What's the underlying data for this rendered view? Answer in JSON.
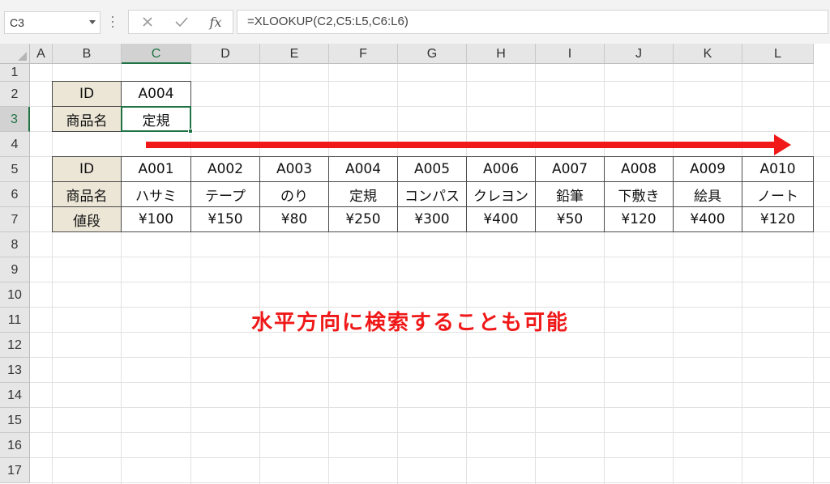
{
  "name_box": {
    "value": "C3"
  },
  "formula_bar": {
    "fx_label": "fx",
    "formula": "=XLOOKUP(C2,C5:L5,C6:L6)"
  },
  "columns": [
    "A",
    "B",
    "C",
    "D",
    "E",
    "F",
    "G",
    "H",
    "I",
    "J",
    "K",
    "L"
  ],
  "selected_column": "C",
  "rows": [
    "1",
    "2",
    "3",
    "4",
    "5",
    "6",
    "7",
    "8",
    "9",
    "10",
    "11",
    "12",
    "13",
    "14",
    "15",
    "16",
    "17"
  ],
  "selected_row": "3",
  "lookup_table": {
    "id_label": "ID",
    "id_value": "A004",
    "name_label": "商品名",
    "name_value": "定規"
  },
  "data_table": {
    "row_labels": [
      "ID",
      "商品名",
      "値段"
    ],
    "ids": [
      "A001",
      "A002",
      "A003",
      "A004",
      "A005",
      "A006",
      "A007",
      "A008",
      "A009",
      "A010"
    ],
    "names": [
      "ハサミ",
      "テープ",
      "のり",
      "定規",
      "コンパス",
      "クレヨン",
      "鉛筆",
      "下敷き",
      "絵具",
      "ノート"
    ],
    "prices": [
      "¥100",
      "¥150",
      "¥80",
      "¥250",
      "¥300",
      "¥400",
      "¥50",
      "¥120",
      "¥400",
      "¥120"
    ]
  },
  "annotation": {
    "text": "水平方向に検索することも可能",
    "color": "#f01818",
    "arrow_direction": "right"
  },
  "colors": {
    "excel_green": "#217346",
    "header_fill": "#ebe6d6"
  }
}
